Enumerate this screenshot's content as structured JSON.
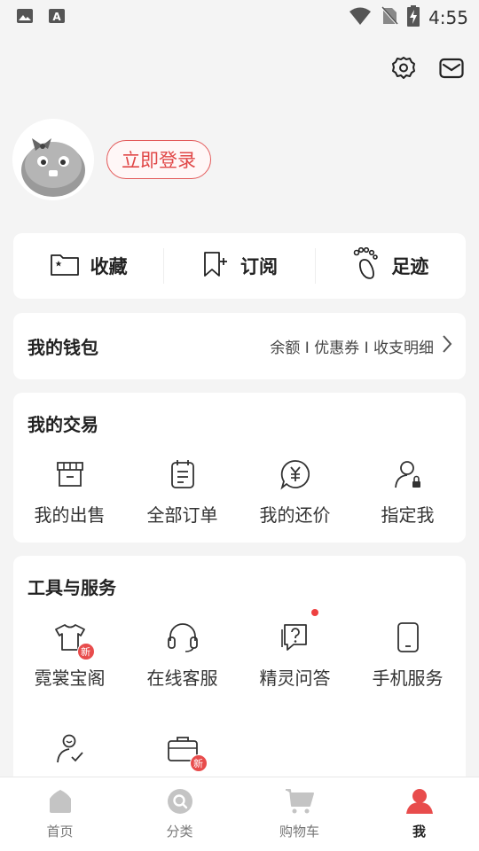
{
  "status_bar": {
    "time": "4:55"
  },
  "profile": {
    "login_label": "立即登录"
  },
  "quick_links": [
    {
      "label": "收藏",
      "icon": "folder-star-icon"
    },
    {
      "label": "订阅",
      "icon": "bookmark-plus-icon"
    },
    {
      "label": "足迹",
      "icon": "footprint-icon"
    }
  ],
  "wallet": {
    "title": "我的钱包",
    "summary": "余额 I 优惠券 I 收支明细"
  },
  "trade": {
    "title": "我的交易",
    "items": [
      {
        "label": "我的出售",
        "icon": "shop-icon"
      },
      {
        "label": "全部订单",
        "icon": "order-list-icon"
      },
      {
        "label": "我的还价",
        "icon": "yuan-bubble-icon"
      },
      {
        "label": "指定我",
        "icon": "person-lock-icon"
      }
    ]
  },
  "tools": {
    "title": "工具与服务",
    "new_badge": "新",
    "items": [
      {
        "label": "霓裳宝阁",
        "icon": "tshirt-icon"
      },
      {
        "label": "在线客服",
        "icon": "headset-icon"
      },
      {
        "label": "精灵问答",
        "icon": "question-chat-icon"
      },
      {
        "label": "手机服务",
        "icon": "phone-icon"
      }
    ],
    "row2": [
      {
        "icon": "person-check-icon"
      },
      {
        "icon": "briefcase-icon"
      }
    ]
  },
  "tabbar": [
    {
      "label": "首页",
      "icon": "home-icon"
    },
    {
      "label": "分类",
      "icon": "search-category-icon"
    },
    {
      "label": "购物车",
      "icon": "cart-icon"
    },
    {
      "label": "我",
      "icon": "user-icon"
    }
  ],
  "colors": {
    "accent": "#e84c4c",
    "background": "#f4f4f4",
    "card": "#ffffff"
  }
}
